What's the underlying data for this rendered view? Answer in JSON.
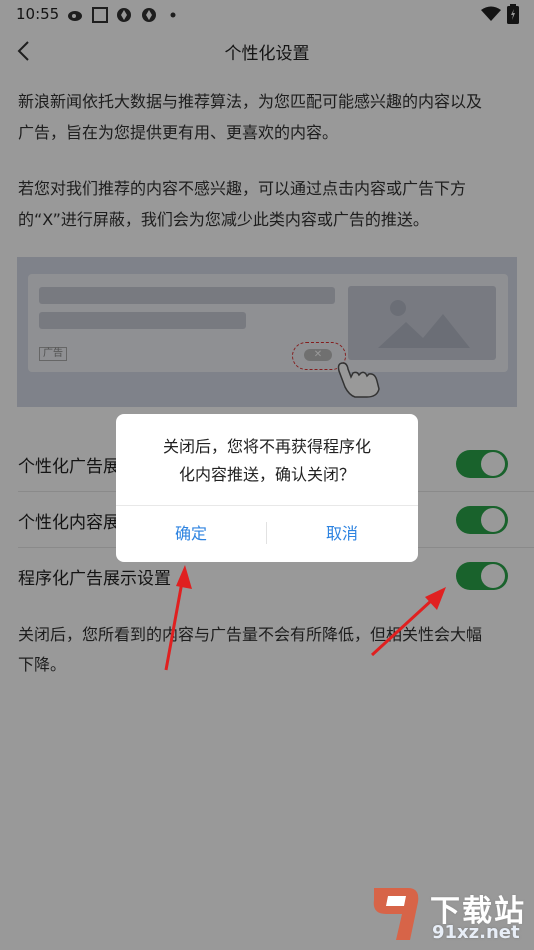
{
  "status_bar": {
    "time": "10:55"
  },
  "header": {
    "title": "个性化设置"
  },
  "intro": {
    "para1_line1": " 新浪新闻依托大数据与推荐算法，为您匹配可能感兴趣的内容以及",
    "para1_line2": "广告，旨在为您提供更有用、更喜欢的内容。",
    "para2_line1": "若您对我们推荐的内容不感兴趣，可以通过点击内容或广告下方",
    "para2_line2": "的“X”进行屏蔽，我们会为您减少此类内容或广告的推送。"
  },
  "illustration": {
    "ad_tag": "广告",
    "close_mark": "✕"
  },
  "settings": [
    {
      "label": "个性化广告展",
      "enabled": true
    },
    {
      "label": "个性化内容展",
      "enabled": true
    },
    {
      "label": "程序化广告展示设置",
      "enabled": true
    }
  ],
  "footer_note": {
    "line1": "关闭后，您所看到的内容与广告量不会有所降低，但相关性会大幅",
    "line2": "下降。"
  },
  "dialog": {
    "message_line1": "关闭后，您将不再获得程序化",
    "message_line2": "化内容推送，确认关闭？",
    "confirm_label": "确定",
    "cancel_label": "取消"
  },
  "watermark": {
    "brand": "下载站",
    "domain": "91xz.net"
  },
  "colors": {
    "toggle_on": "#2aa44a",
    "dialog_button": "#2d83e0",
    "annotation_arrow": "#e02020"
  }
}
